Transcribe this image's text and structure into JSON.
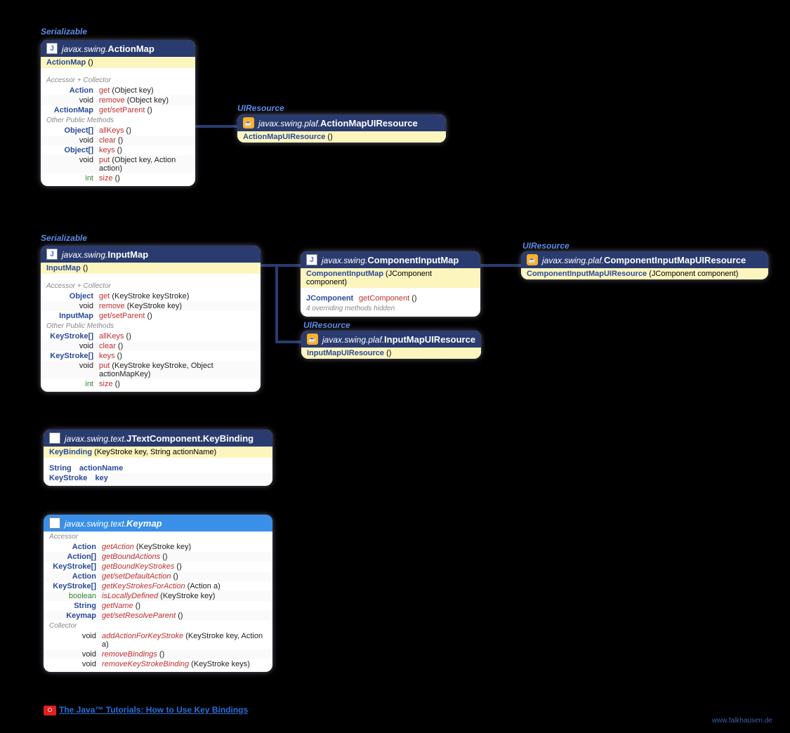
{
  "ifaces": {
    "ser": "Serializable",
    "uir": "UIResource"
  },
  "actionmap": {
    "pkg": "javax.swing.",
    "name": "ActionMap",
    "ctor": {
      "name": "ActionMap",
      "args": " ()"
    },
    "sec1": "Accessor + Collector",
    "m1": [
      {
        "rt": "Action",
        "rtc": "c-nav",
        "n": "get",
        "nc": "c-red",
        "a": " (Object key)"
      },
      {
        "rt": "void",
        "rtc": "c-blk",
        "n": "remove",
        "nc": "c-red",
        "a": " (Object key)"
      },
      {
        "rt": "ActionMap",
        "rtc": "c-nav",
        "n": "get/setParent",
        "nc": "c-red",
        "a": " ()"
      }
    ],
    "sec2": "Other Public Methods",
    "m2": [
      {
        "rt": "Object[]",
        "rtc": "c-nav",
        "n": "allKeys",
        "nc": "c-red",
        "a": " ()"
      },
      {
        "rt": "void",
        "rtc": "c-blk",
        "n": "clear",
        "nc": "c-red",
        "a": " ()"
      },
      {
        "rt": "Object[]",
        "rtc": "c-nav",
        "n": "keys",
        "nc": "c-red",
        "a": " ()"
      },
      {
        "rt": "void",
        "rtc": "c-blk",
        "n": "put",
        "nc": "c-red",
        "a": " (Object key, Action action)"
      },
      {
        "rt": "int",
        "rtc": "c-grn",
        "n": "size",
        "nc": "c-red",
        "a": " ()"
      }
    ]
  },
  "actionmapui": {
    "pkg": "javax.swing.plaf.",
    "name": "ActionMapUIResource",
    "ctor": {
      "name": "ActionMapUIResource",
      "args": " ()"
    }
  },
  "inputmap": {
    "pkg": "javax.swing.",
    "name": "InputMap",
    "ctor": {
      "name": "InputMap",
      "args": " ()"
    },
    "sec1": "Accessor + Collector",
    "m1": [
      {
        "rt": "Object",
        "rtc": "c-nav",
        "n": "get",
        "nc": "c-red",
        "a": " (KeyStroke keyStroke)"
      },
      {
        "rt": "void",
        "rtc": "c-blk",
        "n": "remove",
        "nc": "c-red",
        "a": " (KeyStroke key)"
      },
      {
        "rt": "InputMap",
        "rtc": "c-nav",
        "n": "get/setParent",
        "nc": "c-red",
        "a": " ()"
      }
    ],
    "sec2": "Other Public Methods",
    "m2": [
      {
        "rt": "KeyStroke[]",
        "rtc": "c-nav",
        "n": "allKeys",
        "nc": "c-red",
        "a": " ()"
      },
      {
        "rt": "void",
        "rtc": "c-blk",
        "n": "clear",
        "nc": "c-red",
        "a": " ()"
      },
      {
        "rt": "KeyStroke[]",
        "rtc": "c-nav",
        "n": "keys",
        "nc": "c-red",
        "a": " ()"
      },
      {
        "rt": "void",
        "rtc": "c-blk",
        "n": "put",
        "nc": "c-red",
        "a": " (KeyStroke keyStroke, Object actionMapKey)"
      },
      {
        "rt": "int",
        "rtc": "c-grn",
        "n": "size",
        "nc": "c-red",
        "a": " ()"
      }
    ]
  },
  "compinputmap": {
    "pkg": "javax.swing.",
    "name": "ComponentInputMap",
    "ctor": {
      "name": "ComponentInputMap",
      "args": " (JComponent component)"
    },
    "m1": [
      {
        "rt": "JComponent",
        "rtc": "c-nav",
        "n": "getComponent",
        "nc": "c-red",
        "a": " ()"
      }
    ],
    "note1": "4 overriding",
    "note2": " methods hidden"
  },
  "compinputmapui": {
    "pkg": "javax.swing.plaf.",
    "name": "ComponentInputMapUIResource",
    "ctor": {
      "name": "ComponentInputMapUIResource",
      "args": " (JComponent component)"
    }
  },
  "inputmapui": {
    "pkg": "javax.swing.plaf.",
    "name": "InputMapUIResource",
    "ctor": {
      "name": "InputMapUIResource",
      "args": " ()"
    }
  },
  "keybinding": {
    "pkg": "javax.swing.text.",
    "name": "JTextComponent.KeyBinding",
    "ctor": {
      "name": "KeyBinding",
      "args": " (KeyStroke key, String actionName)"
    },
    "f": [
      {
        "rt": "String",
        "rtc": "c-nav",
        "n": "actionName",
        "nc": "c-nav"
      },
      {
        "rt": "KeyStroke",
        "rtc": "c-nav",
        "n": "key",
        "nc": "c-nav"
      }
    ]
  },
  "keymap": {
    "pkg": "javax.swing.text.",
    "name": "Keymap",
    "sec1": "Accessor",
    "m1": [
      {
        "rt": "Action",
        "rtc": "c-nav",
        "n": "getAction",
        "a": " (KeyStroke key)"
      },
      {
        "rt": "Action[]",
        "rtc": "c-nav",
        "n": "getBoundActions",
        "a": " ()"
      },
      {
        "rt": "KeyStroke[]",
        "rtc": "c-nav",
        "n": "getBoundKeyStrokes",
        "a": " ()"
      },
      {
        "rt": "Action",
        "rtc": "c-nav",
        "n": "get/setDefaultAction",
        "a": " ()"
      },
      {
        "rt": "KeyStroke[]",
        "rtc": "c-nav",
        "n": "getKeyStrokesForAction",
        "a": " (Action a)"
      },
      {
        "rt": "boolean",
        "rtc": "c-grn",
        "n": "isLocallyDefined",
        "a": " (KeyStroke key)"
      },
      {
        "rt": "String",
        "rtc": "c-nav",
        "n": "getName",
        "a": " ()"
      },
      {
        "rt": "Keymap",
        "rtc": "c-nav",
        "n": "get/setResolveParent",
        "a": " ()"
      }
    ],
    "sec2": "Collector",
    "m2": [
      {
        "rt": "void",
        "rtc": "c-blk",
        "n": "addActionForKeyStroke",
        "a": " (KeyStroke key, Action a)"
      },
      {
        "rt": "void",
        "rtc": "c-blk",
        "n": "removeBindings",
        "a": " ()"
      },
      {
        "rt": "void",
        "rtc": "c-blk",
        "n": "removeKeyStrokeBinding",
        "a": " (KeyStroke keys)"
      }
    ]
  },
  "link": "The Java™ Tutorials: How to Use Key Bindings",
  "oracle": "O",
  "credit": "www.falkhausen.de"
}
